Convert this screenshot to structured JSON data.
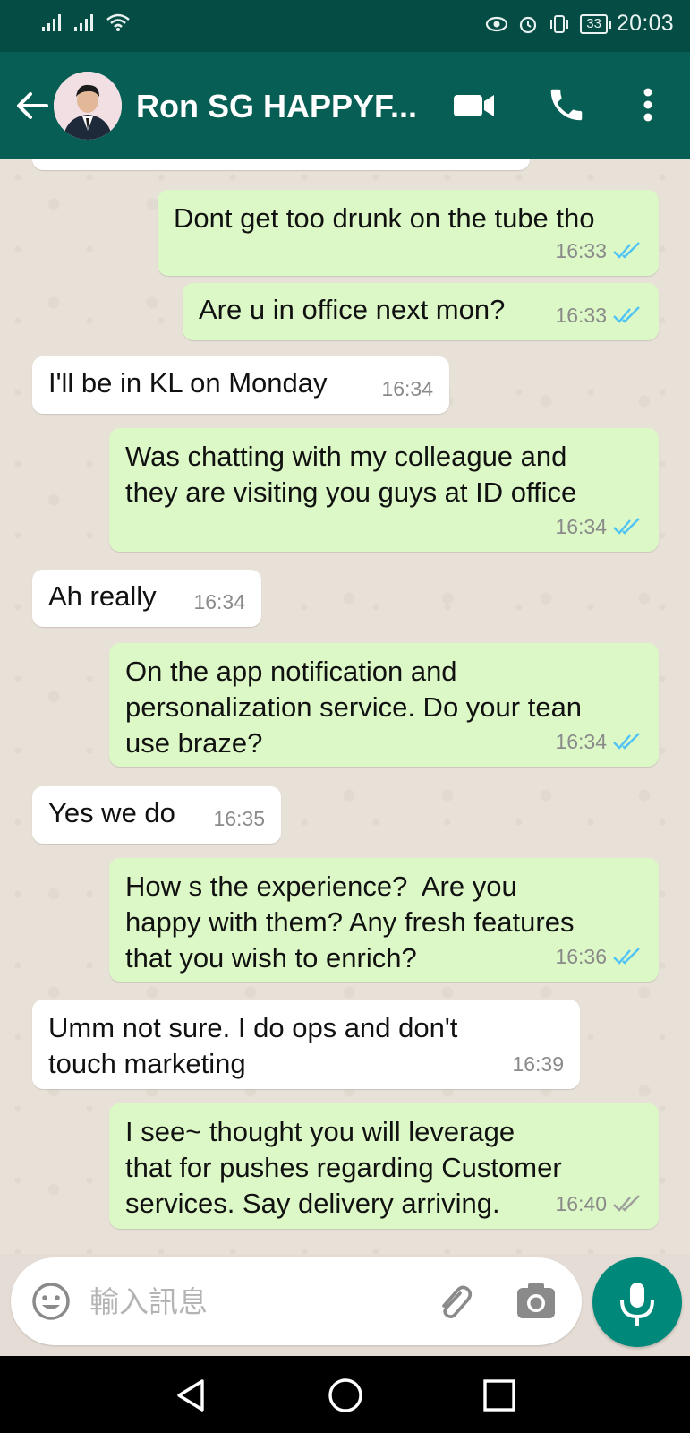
{
  "status_bar": {
    "time": "20:03",
    "battery": "33"
  },
  "header": {
    "contact_name": "Ron SG HAPPYF..."
  },
  "messages": [
    {
      "direction": "out",
      "text": "Dont get too drunk on the tube tho",
      "time": "16:33",
      "status": "read"
    },
    {
      "direction": "out",
      "text": "Are u in office next mon?",
      "time": "16:33",
      "status": "read"
    },
    {
      "direction": "in",
      "text": "I'll be in KL on Monday",
      "time": "16:34"
    },
    {
      "direction": "out",
      "text": "Was chatting with my colleague and\nthey are visiting you guys at ID office",
      "time": "16:34",
      "status": "read"
    },
    {
      "direction": "in",
      "text": "Ah really",
      "time": "16:34"
    },
    {
      "direction": "out",
      "text": "On the app notification and\npersonalization service. Do your tean\nuse braze?",
      "time": "16:34",
      "status": "read"
    },
    {
      "direction": "in",
      "text": "Yes we do",
      "time": "16:35"
    },
    {
      "direction": "out",
      "text": "How s the experience?  Are you\nhappy with them? Any fresh features\nthat you wish to enrich?",
      "time": "16:36",
      "status": "read"
    },
    {
      "direction": "in",
      "text": "Umm not sure. I do ops and don't\ntouch marketing",
      "time": "16:39"
    },
    {
      "direction": "out",
      "text": "I see~ thought you will leverage\nthat for pushes regarding Customer\nservices. Say delivery arriving.",
      "time": "16:40",
      "status": "delivered"
    }
  ],
  "composer": {
    "placeholder": "輸入訊息"
  },
  "colors": {
    "header": "#075e54",
    "status_bar": "#054d44",
    "outgoing_bubble": "#dcf8c6",
    "incoming_bubble": "#ffffff",
    "read_ticks": "#4fc3f7",
    "delivered_ticks": "#9e9e9e",
    "mic_button": "#00897b"
  },
  "icons": [
    "back-arrow-icon",
    "video-call-icon",
    "phone-icon",
    "more-options-icon",
    "emoji-icon",
    "attach-icon",
    "camera-icon",
    "mic-icon",
    "nav-back-icon",
    "nav-home-icon",
    "nav-recents-icon"
  ]
}
